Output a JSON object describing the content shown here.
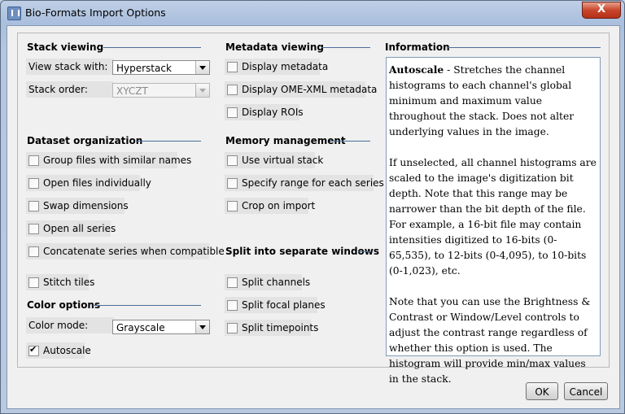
{
  "window": {
    "title": "Bio-Formats Import Options",
    "close_label": "X"
  },
  "stack_viewing": {
    "title": "Stack viewing",
    "view_stack_label": "View stack with:",
    "view_stack_value": "Hyperstack",
    "stack_order_label": "Stack order:",
    "stack_order_value": "XYCZT"
  },
  "dataset_organization": {
    "title": "Dataset organization",
    "options": [
      {
        "label": "Group files with similar names",
        "checked": false
      },
      {
        "label": "Open files individually",
        "checked": false
      },
      {
        "label": "Swap dimensions",
        "checked": false
      },
      {
        "label": "Open all series",
        "checked": false
      },
      {
        "label": "Concatenate series when compatible",
        "checked": false
      },
      {
        "label": "Stitch tiles",
        "checked": false
      }
    ]
  },
  "color_options": {
    "title": "Color options",
    "color_mode_label": "Color mode:",
    "color_mode_value": "Grayscale",
    "autoscale_label": "Autoscale",
    "autoscale_checked": true
  },
  "metadata_viewing": {
    "title": "Metadata viewing",
    "options": [
      {
        "label": "Display metadata",
        "checked": false
      },
      {
        "label": "Display OME-XML metadata",
        "checked": false
      },
      {
        "label": "Display ROIs",
        "checked": false
      }
    ]
  },
  "memory_management": {
    "title": "Memory management",
    "options": [
      {
        "label": "Use virtual stack",
        "checked": false
      },
      {
        "label": "Specify range for each series",
        "checked": false
      },
      {
        "label": "Crop on import",
        "checked": false
      }
    ]
  },
  "split_windows": {
    "title": "Split into separate windows",
    "options": [
      {
        "label": "Split channels",
        "checked": false
      },
      {
        "label": "Split focal planes",
        "checked": false
      },
      {
        "label": "Split timepoints",
        "checked": false
      }
    ]
  },
  "information": {
    "title": "Information",
    "term": "Autoscale",
    "p1_rest": " - Stretches the channel histograms to each channel's global minimum and maximum value throughout the stack. Does not alter underlying values in the image.",
    "p2": "If unselected, all channel histograms are scaled to the image's digitization bit depth. Note that this range may be narrower than the bit depth of the file. For example, a 16-bit file may contain intensities digitized to 16-bits (0-65,535), to 12-bits (0-4,095), to 10-bits (0-1,023), etc.",
    "p3": "Note that you can use the Brightness & Contrast or Window/Level controls to adjust the contrast range regardless of whether this option is used. The histogram will provide min/max values in the stack."
  },
  "buttons": {
    "ok": "OK",
    "cancel": "Cancel"
  }
}
